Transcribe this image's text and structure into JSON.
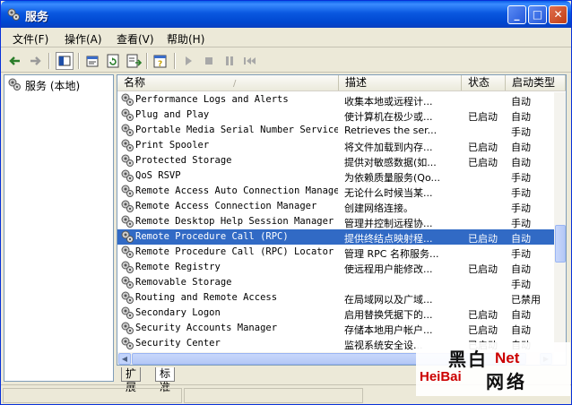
{
  "window": {
    "title": "服务"
  },
  "title_buttons": {
    "minimize": "_",
    "maximize": "□",
    "close": "✕"
  },
  "menu": [
    "文件(F)",
    "操作(A)",
    "查看(V)",
    "帮助(H)"
  ],
  "toolbar_icons": [
    "back-arrow-icon",
    "forward-arrow-icon",
    "show-hide-tree-icon",
    "properties-icon",
    "refresh-icon",
    "export-list-icon",
    "help-icon",
    "start-service-icon",
    "stop-service-icon",
    "pause-service-icon",
    "restart-service-icon"
  ],
  "tree": {
    "root": "服务 (本地)"
  },
  "columns": {
    "name": "名称",
    "desc": "描述",
    "status": "状态",
    "startup": "启动类型",
    "sort_arrow": "/"
  },
  "services": [
    {
      "name": "Performance Logs and Alerts",
      "desc": "收集本地或远程计...",
      "status": "",
      "startup": "自动"
    },
    {
      "name": "Plug and Play",
      "desc": "使计算机在极少或...",
      "status": "已启动",
      "startup": "自动"
    },
    {
      "name": "Portable Media Serial Number Service",
      "desc": "Retrieves the ser...",
      "status": "",
      "startup": "手动"
    },
    {
      "name": "Print Spooler",
      "desc": "将文件加载到内存...",
      "status": "已启动",
      "startup": "自动"
    },
    {
      "name": "Protected Storage",
      "desc": "提供对敏感数据(如...",
      "status": "已启动",
      "startup": "自动"
    },
    {
      "name": "QoS RSVP",
      "desc": "为依赖质量服务(Qo...",
      "status": "",
      "startup": "手动"
    },
    {
      "name": "Remote Access Auto Connection Manager",
      "desc": "无论什么时候当某...",
      "status": "",
      "startup": "手动"
    },
    {
      "name": "Remote Access Connection Manager",
      "desc": "创建网络连接。",
      "status": "",
      "startup": "手动"
    },
    {
      "name": "Remote Desktop Help Session Manager",
      "desc": "管理并控制远程协...",
      "status": "",
      "startup": "手动"
    },
    {
      "name": "Remote Procedure Call (RPC)",
      "desc": "提供终结点映射程...",
      "status": "已启动",
      "startup": "自动",
      "selected": true
    },
    {
      "name": "Remote Procedure Call (RPC) Locator",
      "desc": "管理 RPC 名称服务...",
      "status": "",
      "startup": "手动"
    },
    {
      "name": "Remote Registry",
      "desc": "使远程用户能修改...",
      "status": "已启动",
      "startup": "自动"
    },
    {
      "name": "Removable Storage",
      "desc": "",
      "status": "",
      "startup": "手动"
    },
    {
      "name": "Routing and Remote Access",
      "desc": "在局域网以及广域...",
      "status": "",
      "startup": "已禁用"
    },
    {
      "name": "Secondary Logon",
      "desc": "启用替换凭据下的...",
      "status": "已启动",
      "startup": "自动"
    },
    {
      "name": "Security Accounts Manager",
      "desc": "存储本地用户帐户...",
      "status": "已启动",
      "startup": "自动"
    },
    {
      "name": "Security Center",
      "desc": "监视系统安全设...",
      "status": "已启动",
      "startup": "自动"
    }
  ],
  "tabs": [
    "扩展",
    "标准"
  ],
  "watermark": {
    "line1": "黑白",
    "net": "Net",
    "line2": "HeiBai",
    "line3": "网络"
  },
  "colors": {
    "selection": "#316ac5",
    "titlebar": "#0a58e0",
    "face": "#ece9d8"
  }
}
